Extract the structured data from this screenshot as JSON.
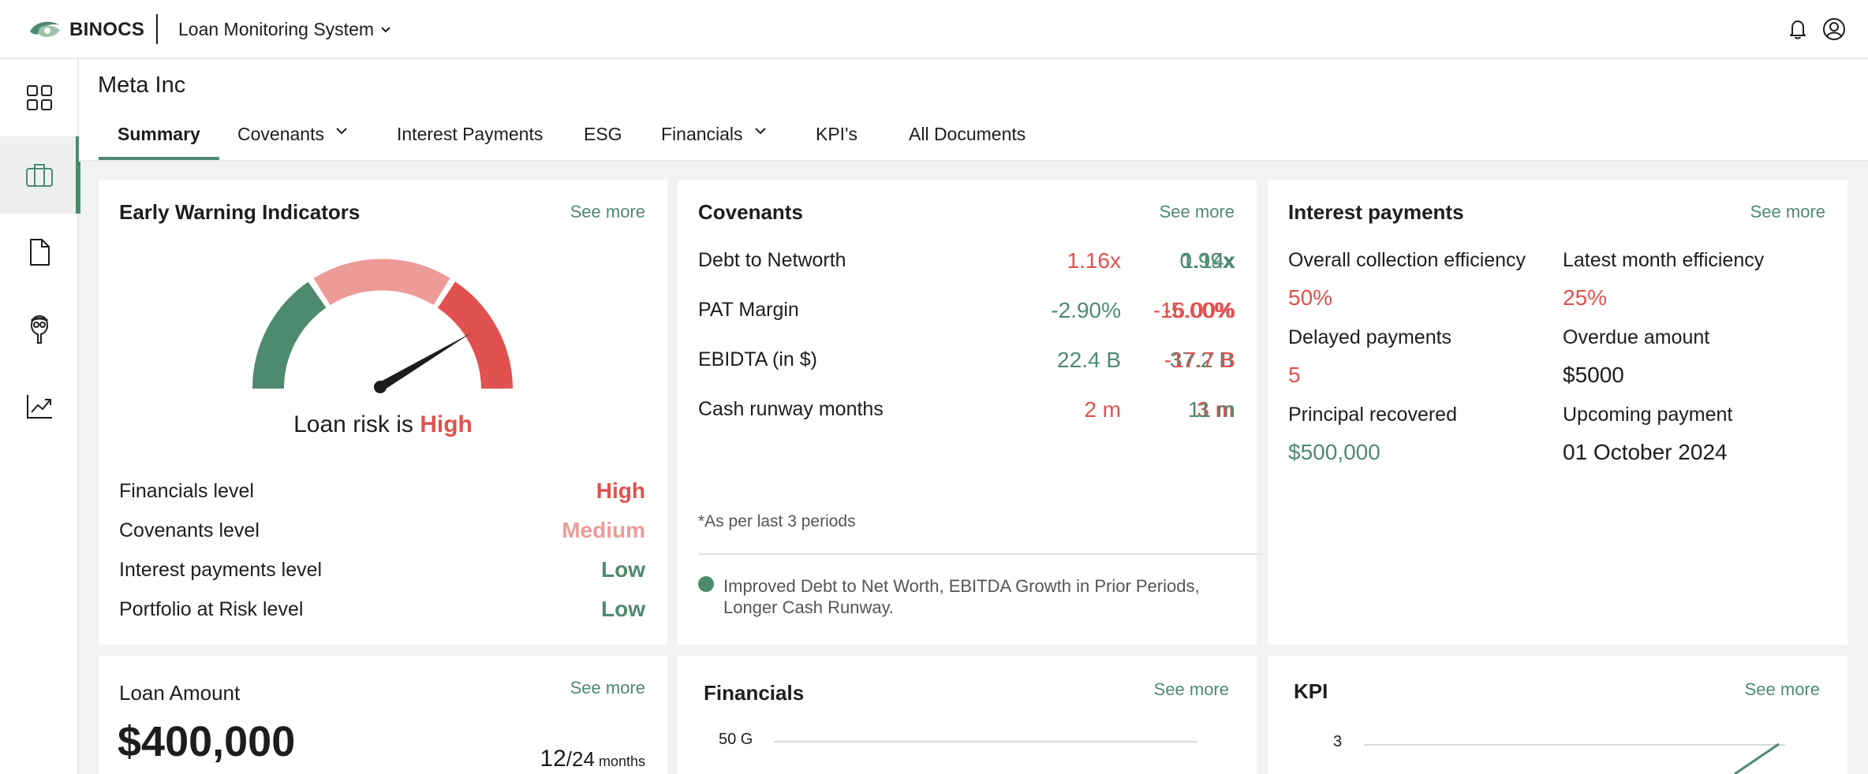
{
  "topbar": {
    "brand": "BINOCS",
    "app_name": "Loan Monitoring System"
  },
  "sidebar": {
    "items": [
      {
        "name": "dashboard",
        "icon": "grid-icon"
      },
      {
        "name": "portfolio",
        "icon": "briefcase-icon"
      },
      {
        "name": "documents",
        "icon": "document-icon"
      },
      {
        "name": "analyst",
        "icon": "analyst-icon"
      },
      {
        "name": "analytics",
        "icon": "trend-chart-icon"
      }
    ]
  },
  "header": {
    "company": "Meta Inc",
    "tabs": [
      "Summary",
      "Covenants",
      "Interest Payments",
      "ESG",
      "Financials",
      "KPI's",
      "All Documents"
    ]
  },
  "ewi": {
    "title": "Early Warning Indicators",
    "see_more": "See more",
    "risk_prefix": "Loan risk is",
    "risk_value": "High",
    "rows": [
      {
        "label": "Financials level",
        "value": "High"
      },
      {
        "label": "Covenants level",
        "value": "Medium"
      },
      {
        "label": "Interest payments level",
        "value": "Low"
      },
      {
        "label": "Portfolio at Risk level",
        "value": "Low"
      }
    ],
    "colors": {
      "low": "#4e8a70",
      "medium": "#ec9b98",
      "high": "#e0514f"
    }
  },
  "covenants": {
    "title": "Covenants",
    "see_more": "See more",
    "rows": [
      {
        "label": "Debt to Networth",
        "values": [
          "1.16x",
          "0.99x",
          "1.14x"
        ]
      },
      {
        "label": "PAT Margin",
        "values": [
          "-2.90%",
          "-5.00%",
          "-16.00%"
        ]
      },
      {
        "label": "EBIDTA (in $)",
        "values": [
          "22.4 B",
          "37.2 B",
          "-17.7 B"
        ]
      },
      {
        "label": "Cash runway months",
        "values": [
          "2 m",
          "3 m",
          "11 m"
        ]
      }
    ],
    "note": "*As per last 3 periods",
    "insight": "Improved Debt to Net Worth, EBITDA Growth in Prior Periods, Longer Cash Runway."
  },
  "interest": {
    "title": "Interest payments",
    "see_more": "See more",
    "items": [
      {
        "label": "Overall collection efficiency",
        "value": "50%"
      },
      {
        "label": "Latest month efficiency",
        "value": "25%"
      },
      {
        "label": "Delayed payments",
        "value": "5"
      },
      {
        "label": "Overdue amount",
        "value": "$5000"
      },
      {
        "label": "Principal recovered",
        "value": "$500,000"
      },
      {
        "label": "Upcoming payment",
        "value": "01 October 2024"
      }
    ]
  },
  "loan": {
    "title": "Loan Amount",
    "see_more": "See more",
    "amount": "$400,000",
    "term_done": "12",
    "term_total": "/24",
    "term_unit": "months"
  },
  "financials": {
    "title": "Financials",
    "see_more": "See more",
    "tick": "50 G"
  },
  "kpi": {
    "title": "KPI",
    "see_more": "See more",
    "tick": "3"
  }
}
